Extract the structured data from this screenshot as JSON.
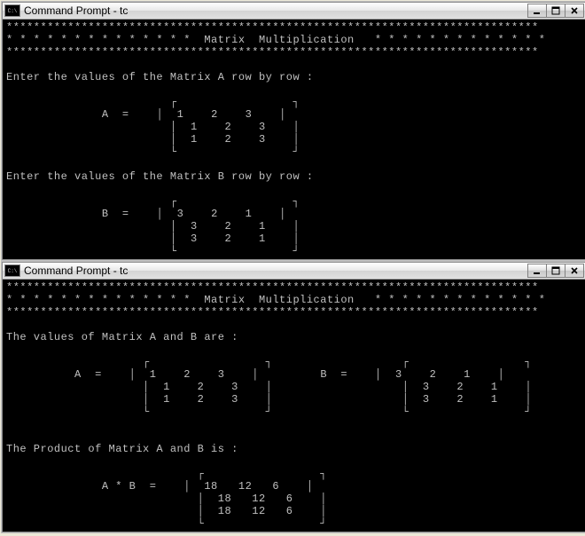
{
  "window1": {
    "title": "Command Prompt - tc",
    "border": "******************************************************************************",
    "starline": "* * * * * * * * * * * * * *  Matrix  Multiplication   * * * * * * * * * * * * *",
    "prompt_a": "Enter the values of the Matrix A row by row :",
    "a_label": "A  =",
    "matrix_a": {
      "rows": [
        [
          "1",
          "2",
          "3"
        ],
        [
          "1",
          "2",
          "3"
        ],
        [
          "1",
          "2",
          "3"
        ]
      ]
    },
    "prompt_b": "Enter the values of the Matrix B row by row :",
    "b_label": "B  =",
    "matrix_b": {
      "rows": [
        [
          "3",
          "2",
          "1"
        ],
        [
          "3",
          "2",
          "1"
        ],
        [
          "3",
          "2",
          "1"
        ]
      ]
    }
  },
  "window2": {
    "title": "Command Prompt - tc",
    "border": "******************************************************************************",
    "starline": "* * * * * * * * * * * * * *  Matrix  Multiplication   * * * * * * * * * * * * *",
    "values_line": "The values of Matrix A and B are :",
    "a_label": "A  =",
    "b_label": "B  =",
    "matrix_a": {
      "rows": [
        [
          "1",
          "2",
          "3"
        ],
        [
          "1",
          "2",
          "3"
        ],
        [
          "1",
          "2",
          "3"
        ]
      ]
    },
    "matrix_b": {
      "rows": [
        [
          "3",
          "2",
          "1"
        ],
        [
          "3",
          "2",
          "1"
        ],
        [
          "3",
          "2",
          "1"
        ]
      ]
    },
    "product_line": "The Product of Matrix A and B is :",
    "ab_label": "A * B  =",
    "matrix_ab": {
      "rows": [
        [
          "18",
          "12",
          "6"
        ],
        [
          "18",
          "12",
          "6"
        ],
        [
          "18",
          "12",
          "6"
        ]
      ]
    }
  },
  "chart_data": {
    "type": "table",
    "title": "Matrix Multiplication",
    "matrices": {
      "A": [
        [
          1,
          2,
          3
        ],
        [
          1,
          2,
          3
        ],
        [
          1,
          2,
          3
        ]
      ],
      "B": [
        [
          3,
          2,
          1
        ],
        [
          3,
          2,
          1
        ],
        [
          3,
          2,
          1
        ]
      ],
      "AxB": [
        [
          18,
          12,
          6
        ],
        [
          18,
          12,
          6
        ],
        [
          18,
          12,
          6
        ]
      ]
    }
  }
}
